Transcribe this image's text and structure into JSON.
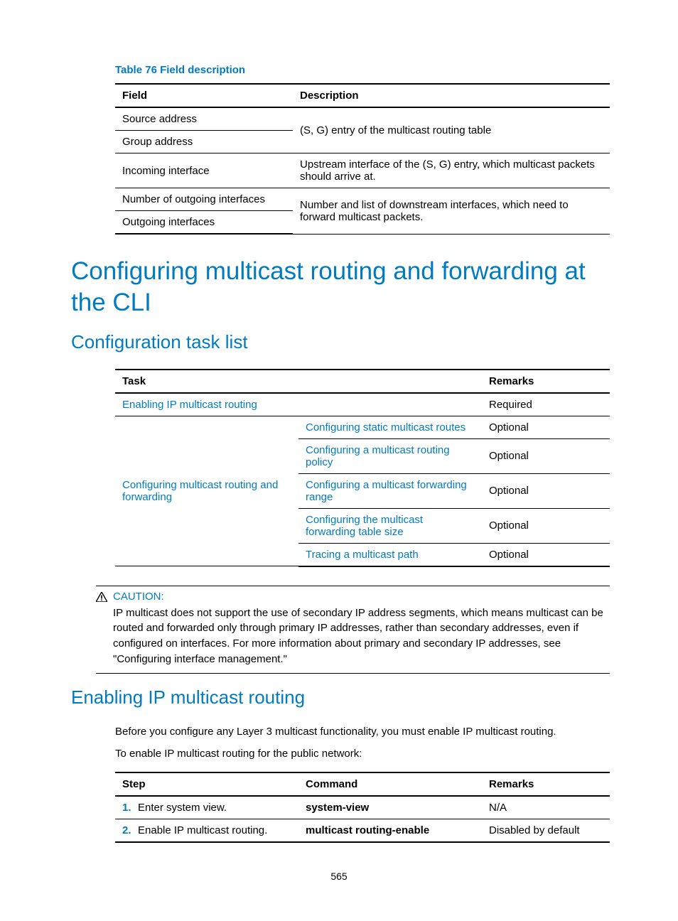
{
  "table76": {
    "caption": "Table 76 Field description",
    "headers": {
      "field": "Field",
      "description": "Description"
    },
    "rows": {
      "r1_field": "Source address",
      "r2_field": "Group address",
      "r12_desc": "(S, G) entry of the multicast routing table",
      "r3_field": "Incoming interface",
      "r3_desc": "Upstream interface of the (S, G) entry, which multicast packets should arrive at.",
      "r4_field": "Number of outgoing interfaces",
      "r5_field": "Outgoing interfaces",
      "r45_desc": "Number and list of downstream interfaces, which need to forward multicast packets."
    }
  },
  "headings": {
    "h1": "Configuring multicast routing and forwarding at the CLI",
    "h2a": "Configuration task list",
    "h2b": "Enabling IP multicast routing"
  },
  "tasks": {
    "headers": {
      "task": "Task",
      "remarks": "Remarks"
    },
    "row1": {
      "task": "Enabling IP multicast routing",
      "remarks": "Required"
    },
    "group_label": "Configuring multicast routing and forwarding",
    "sub1": {
      "task": "Configuring static multicast routes",
      "remarks": "Optional"
    },
    "sub2": {
      "task": "Configuring a multicast routing policy",
      "remarks": "Optional"
    },
    "sub3": {
      "task": "Configuring a multicast forwarding range",
      "remarks": "Optional"
    },
    "sub4": {
      "task": "Configuring the multicast forwarding table size",
      "remarks": "Optional"
    },
    "sub5": {
      "task": "Tracing a multicast path",
      "remarks": "Optional"
    }
  },
  "caution": {
    "label": "CAUTION:",
    "text": "IP multicast does not support the use of secondary IP address segments, which means multicast can be routed and forwarded only through primary IP addresses, rather than secondary addresses, even if configured on interfaces. For more information about primary and secondary IP addresses, see \"Configuring interface management.\""
  },
  "paragraphs": {
    "p1": "Before you configure any Layer 3 multicast functionality, you must enable IP multicast routing.",
    "p2": "To enable IP multicast routing for the public network:"
  },
  "steps": {
    "headers": {
      "step": "Step",
      "command": "Command",
      "remarks": "Remarks"
    },
    "r1": {
      "num": "1.",
      "step": "Enter system view.",
      "command": "system-view",
      "remarks": "N/A"
    },
    "r2": {
      "num": "2.",
      "step": "Enable IP multicast routing.",
      "command": "multicast routing-enable",
      "remarks": "Disabled by default"
    }
  },
  "page_number": "565"
}
